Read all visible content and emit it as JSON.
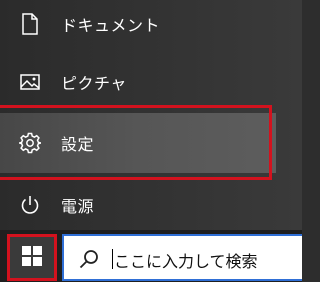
{
  "start_menu": {
    "items": [
      {
        "label": "ドキュメント",
        "icon": "document-icon"
      },
      {
        "label": "ピクチャ",
        "icon": "pictures-icon"
      },
      {
        "label": "設定",
        "icon": "gear-icon",
        "highlighted": true
      },
      {
        "label": "電源",
        "icon": "power-icon"
      }
    ]
  },
  "taskbar": {
    "start_icon": "windows-logo-icon",
    "search": {
      "placeholder": "ここに入力して検索",
      "icon": "search-icon"
    }
  },
  "colors": {
    "menu_bg": "#2b2b2b",
    "selected_bg": "#565656",
    "taskbar_bg": "#1f1f1f",
    "highlight_box": "#d3121e",
    "search_border": "#2f6fd6",
    "text": "#ffffff"
  }
}
